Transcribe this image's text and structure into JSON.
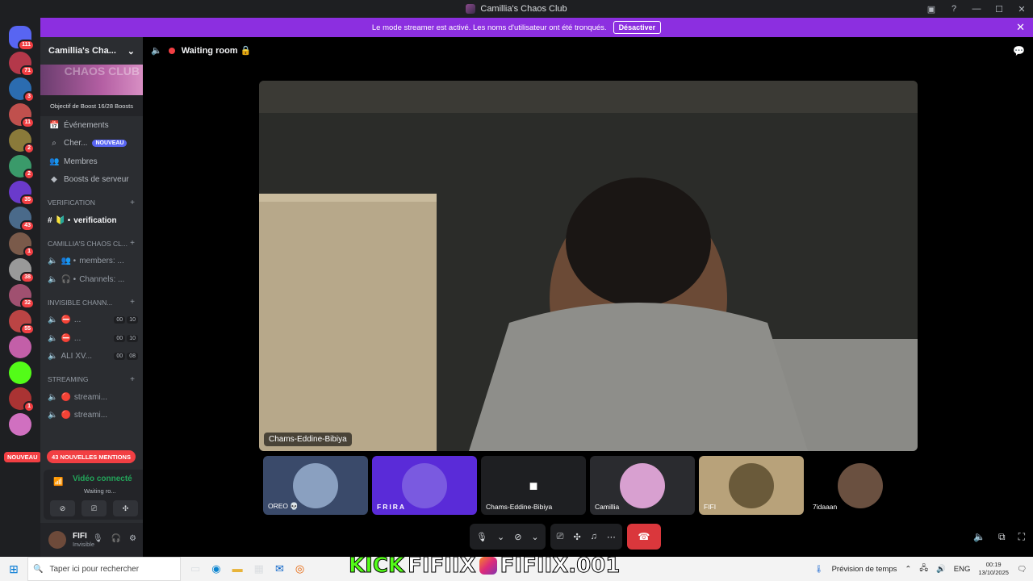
{
  "window": {
    "title": "Camillia's Chaos Club"
  },
  "banner": {
    "text": "Le mode streamer est activé. Les noms d'utilisateur ont été tronqués.",
    "button": "Désactiver"
  },
  "guilds": [
    {
      "badge": "111"
    },
    {
      "badge": "71"
    },
    {
      "badge": "3"
    },
    {
      "badge": "11"
    },
    {
      "badge": "2"
    },
    {
      "badge": "2"
    },
    {
      "badge": "35"
    },
    {
      "badge": "43"
    },
    {
      "badge": "1"
    },
    {
      "badge": "38"
    },
    {
      "badge": "32"
    },
    {
      "badge": "55"
    },
    {
      "badge": ""
    },
    {
      "badge": ""
    },
    {
      "badge": "1"
    },
    {
      "badge": ""
    }
  ],
  "guild_new": "NOUVEAU",
  "sidebar": {
    "server_name": "Camillia's Cha...",
    "banner_text": "CHAOS CLUB",
    "boost_goal": "Objectif de Boost",
    "boost_count": "16/28 Boosts",
    "nav": [
      {
        "label": "Événements",
        "icon": "calendar-icon"
      },
      {
        "label": "Cher...",
        "icon": "search-icon",
        "pill": "NOUVEAU"
      },
      {
        "label": "Membres",
        "icon": "members-icon"
      },
      {
        "label": "Boosts de serveur",
        "icon": "boost-icon"
      }
    ],
    "categories": [
      {
        "name": "VERIFICATION",
        "channels": [
          {
            "label": "verification",
            "prefix": "🔰 •",
            "active": true
          }
        ]
      },
      {
        "name": "Camillia's Chaos Cl...",
        "channels": [
          {
            "label": "members: ...",
            "prefix": "👥 •"
          },
          {
            "label": "Channels: ...",
            "prefix": "🎧 •"
          }
        ]
      },
      {
        "name": "INVISIBLE CHANN...",
        "channels": [
          {
            "label": "...",
            "prefix": "⛔",
            "c1": "00",
            "c2": "10"
          },
          {
            "label": "...",
            "prefix": "⛔",
            "c1": "00",
            "c2": "10"
          },
          {
            "label": "ALI XV...",
            "prefix": "",
            "c1": "00",
            "c2": "08"
          }
        ]
      },
      {
        "name": "STREAMING",
        "channels": [
          {
            "label": "streami...",
            "prefix": "🔴"
          },
          {
            "label": "streami...",
            "prefix": "🔴"
          }
        ]
      }
    ],
    "mentions": "43 NOUVELLES MENTIONS"
  },
  "voice": {
    "status": "Vidéo connecté",
    "room": "Waiting ro..."
  },
  "user": {
    "name": "FIFI",
    "status": "Invisible"
  },
  "stage": {
    "room_title": "Waiting room 🔒",
    "main_name": "Chams-Eddine-Bibiya",
    "tiles": [
      {
        "name": "OREO 💀"
      },
      {
        "name": "FRIRA"
      },
      {
        "name": "Chams-Eddine-Bibiya"
      },
      {
        "name": "Camillia"
      },
      {
        "name": "FIFI"
      },
      {
        "name": "7idaaan"
      }
    ]
  },
  "taskbar": {
    "search_placeholder": "Taper ici pour rechercher",
    "overlay_kick": "KICK",
    "overlay_handle1": "FIFIIX",
    "overlay_handle2": "FIFIIX.001",
    "weather": "Prévision de temps",
    "lang": "ENG",
    "time": "00:19",
    "date": "13/10/2025"
  },
  "colors": {
    "accent": "#8c2fe0",
    "danger": "#f23f43",
    "online": "#23a55a",
    "kick": "#53fc18"
  }
}
